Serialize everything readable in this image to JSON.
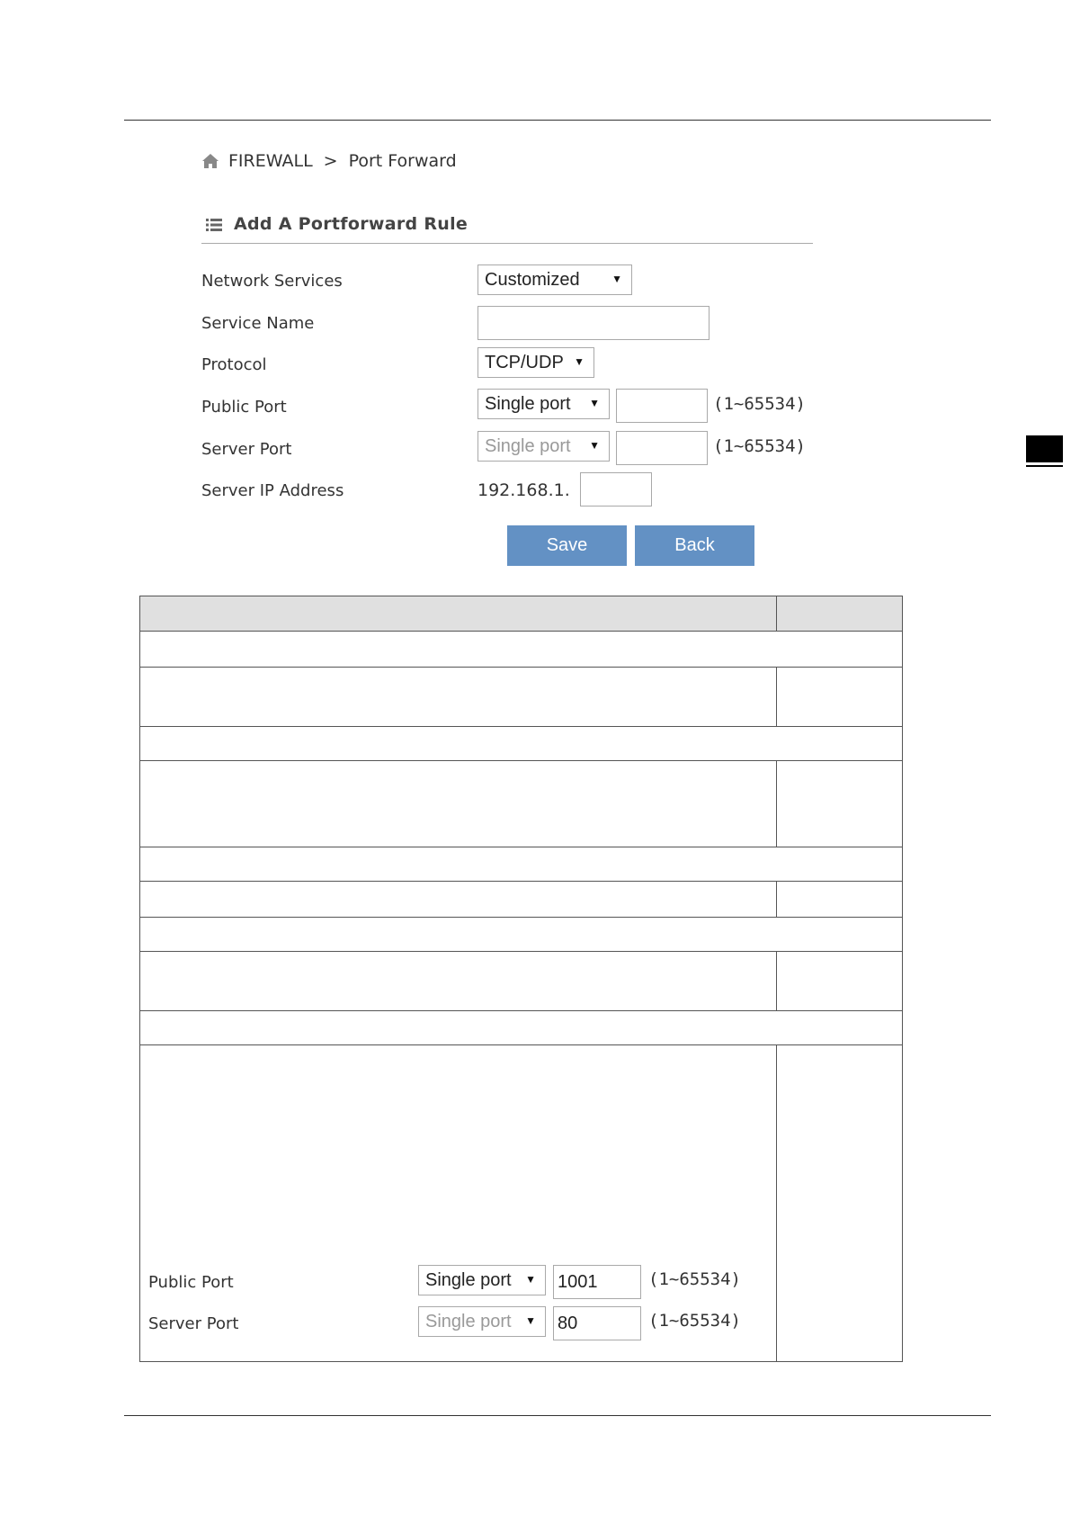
{
  "breadcrumb": {
    "section": "FIREWALL",
    "separator": ">",
    "page": "Port Forward"
  },
  "form": {
    "title": "Add A Portforward Rule",
    "labels": {
      "network_services": "Network Services",
      "service_name": "Service Name",
      "protocol": "Protocol",
      "public_port": "Public Port",
      "server_port": "Server Port",
      "server_ip": "Server IP Address"
    },
    "network_services_value": "Customized",
    "service_name_value": "",
    "protocol_value": "TCP/UDP",
    "public_port_mode": "Single port",
    "public_port_value": "",
    "server_port_mode": "Single port",
    "server_port_value": "",
    "range_hint": "(1~65534)",
    "ip_prefix": "192.168.1.",
    "ip_last_octet": "",
    "save_label": "Save",
    "back_label": "Back"
  },
  "example": {
    "public_port_label": "Public Port",
    "server_port_label": "Server Port",
    "public_port_mode": "Single port",
    "public_port_value": "1001",
    "server_port_mode": "Single port",
    "server_port_value": "80",
    "range_hint": "(1~65534)"
  },
  "icons": {
    "home": "home-icon",
    "list": "list-icon",
    "dropdown": "triangle-down-icon"
  },
  "colors": {
    "button": "#6391c4",
    "table_header": "#e0e0e0"
  }
}
